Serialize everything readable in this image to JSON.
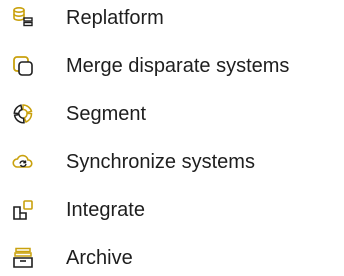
{
  "colors": {
    "accent": "#c9a10d",
    "text": "#1e1e1e"
  },
  "menu": {
    "items": [
      {
        "label": "Replatform",
        "icon": "database-migrate-icon"
      },
      {
        "label": "Merge disparate systems",
        "icon": "merge-squares-icon"
      },
      {
        "label": "Segment",
        "icon": "segment-donut-icon"
      },
      {
        "label": "Synchronize systems",
        "icon": "sync-cloud-icon"
      },
      {
        "label": "Integrate",
        "icon": "integrate-blocks-icon"
      },
      {
        "label": "Archive",
        "icon": "archive-box-icon"
      }
    ]
  }
}
